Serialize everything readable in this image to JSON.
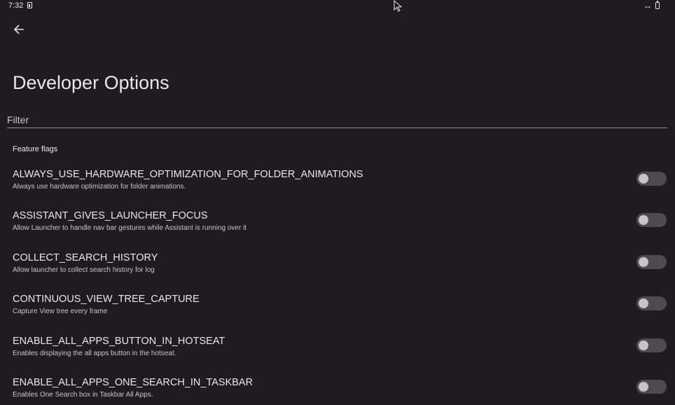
{
  "status_bar": {
    "time": "7:32"
  },
  "header": {
    "title": "Developer Options"
  },
  "filter": {
    "placeholder": "Filter",
    "value": ""
  },
  "section": {
    "title": "Feature flags"
  },
  "flags": [
    {
      "name": "ALWAYS_USE_HARDWARE_OPTIMIZATION_FOR_FOLDER_ANIMATIONS",
      "description": "Always use hardware optimization for folder animations.",
      "enabled": false
    },
    {
      "name": "ASSISTANT_GIVES_LAUNCHER_FOCUS",
      "description": "Allow Launcher to handle nav bar gestures while Assistant is running over it",
      "enabled": false
    },
    {
      "name": "COLLECT_SEARCH_HISTORY",
      "description": "Allow launcher to collect search history for log",
      "enabled": false
    },
    {
      "name": "CONTINUOUS_VIEW_TREE_CAPTURE",
      "description": "Capture View tree every frame",
      "enabled": false
    },
    {
      "name": "ENABLE_ALL_APPS_BUTTON_IN_HOTSEAT",
      "description": "Enables displaying the all apps button in the hotseat.",
      "enabled": false
    },
    {
      "name": "ENABLE_ALL_APPS_ONE_SEARCH_IN_TASKBAR",
      "description": "Enables One Search box in Taskbar All Apps.",
      "enabled": false
    }
  ],
  "colors": {
    "background": "#1f1b1f",
    "text_primary": "#ece6ea",
    "text_secondary": "#cac4c9",
    "toggle_track_off": "#4e4a4e",
    "toggle_thumb_off": "#c8c2c7"
  },
  "icons": {
    "back": "arrow-left-icon",
    "sim": "sim-card-icon",
    "resize": "horizontal-resize-icon",
    "battery": "battery-icon",
    "cursor": "mouse-pointer-icon"
  }
}
